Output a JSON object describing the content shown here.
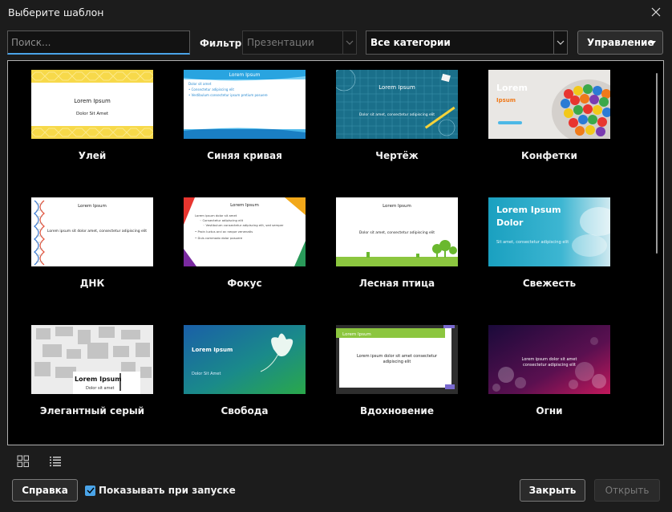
{
  "window": {
    "title": "Выберите шаблон"
  },
  "search": {
    "placeholder": "Поиск..."
  },
  "filter": {
    "label": "Фильтр",
    "type_value": "Презентации",
    "category_value": "Все категории"
  },
  "manage": {
    "label": "Управление"
  },
  "templates": [
    {
      "name": "Улей",
      "thumb_title": "Lorem Ipsum",
      "thumb_sub": "Dolor Sit Amet"
    },
    {
      "name": "Синяя кривая",
      "thumb_title": "Lorem Ipsum",
      "thumb_sub": "Dolor sit amet"
    },
    {
      "name": "Чертёж",
      "thumb_title": "Lorem Ipsum",
      "thumb_sub": "Dolor sit amet, consectetur adipiscing elit"
    },
    {
      "name": "Конфетки",
      "thumb_title": "Lorem",
      "thumb_sub": "Ipsum"
    },
    {
      "name": "ДНК",
      "thumb_title": "Lorem Ipsum",
      "thumb_sub": "Lorem ipsum sit dolor amet, consectetur adipiscing elit"
    },
    {
      "name": "Фокус",
      "thumb_title": "Lorem Ipsum",
      "thumb_sub": "Lorem ipsum dolor sit amet"
    },
    {
      "name": "Лесная птица",
      "thumb_title": "Lorem Ipsum",
      "thumb_sub": "Dolor sit amet, consectetur adipiscing elit"
    },
    {
      "name": "Свежесть",
      "thumb_title": "Lorem Ipsum Dolor",
      "thumb_sub": "Sit amet, consectetur adipiscing elit"
    },
    {
      "name": "Элегантный серый",
      "thumb_title": "Lorem Ipsum",
      "thumb_sub": "Dolor sit amet"
    },
    {
      "name": "Свобода",
      "thumb_title": "Lorem Ipsum",
      "thumb_sub": "Dolor Sit Amet"
    },
    {
      "name": "Вдохновение",
      "thumb_title": "Lorem Ipsum",
      "thumb_sub": "Lorem ipsum dolor sit amet consectetur adipiscing elit"
    },
    {
      "name": "Огни",
      "thumb_title": "Lorem ipsum dolor sit amet",
      "thumb_sub": "consectetur adipiscing elit"
    }
  ],
  "footer": {
    "help_label": "Справка",
    "show_on_start_label": "Показывать при запуске",
    "close_label": "Закрыть",
    "open_label": "Открыть"
  },
  "icons": {
    "close": "close-icon",
    "dropdown": "chevron-down-icon",
    "grid_view": "grid-view-icon",
    "list_view": "list-view-icon",
    "check": "check-icon"
  }
}
